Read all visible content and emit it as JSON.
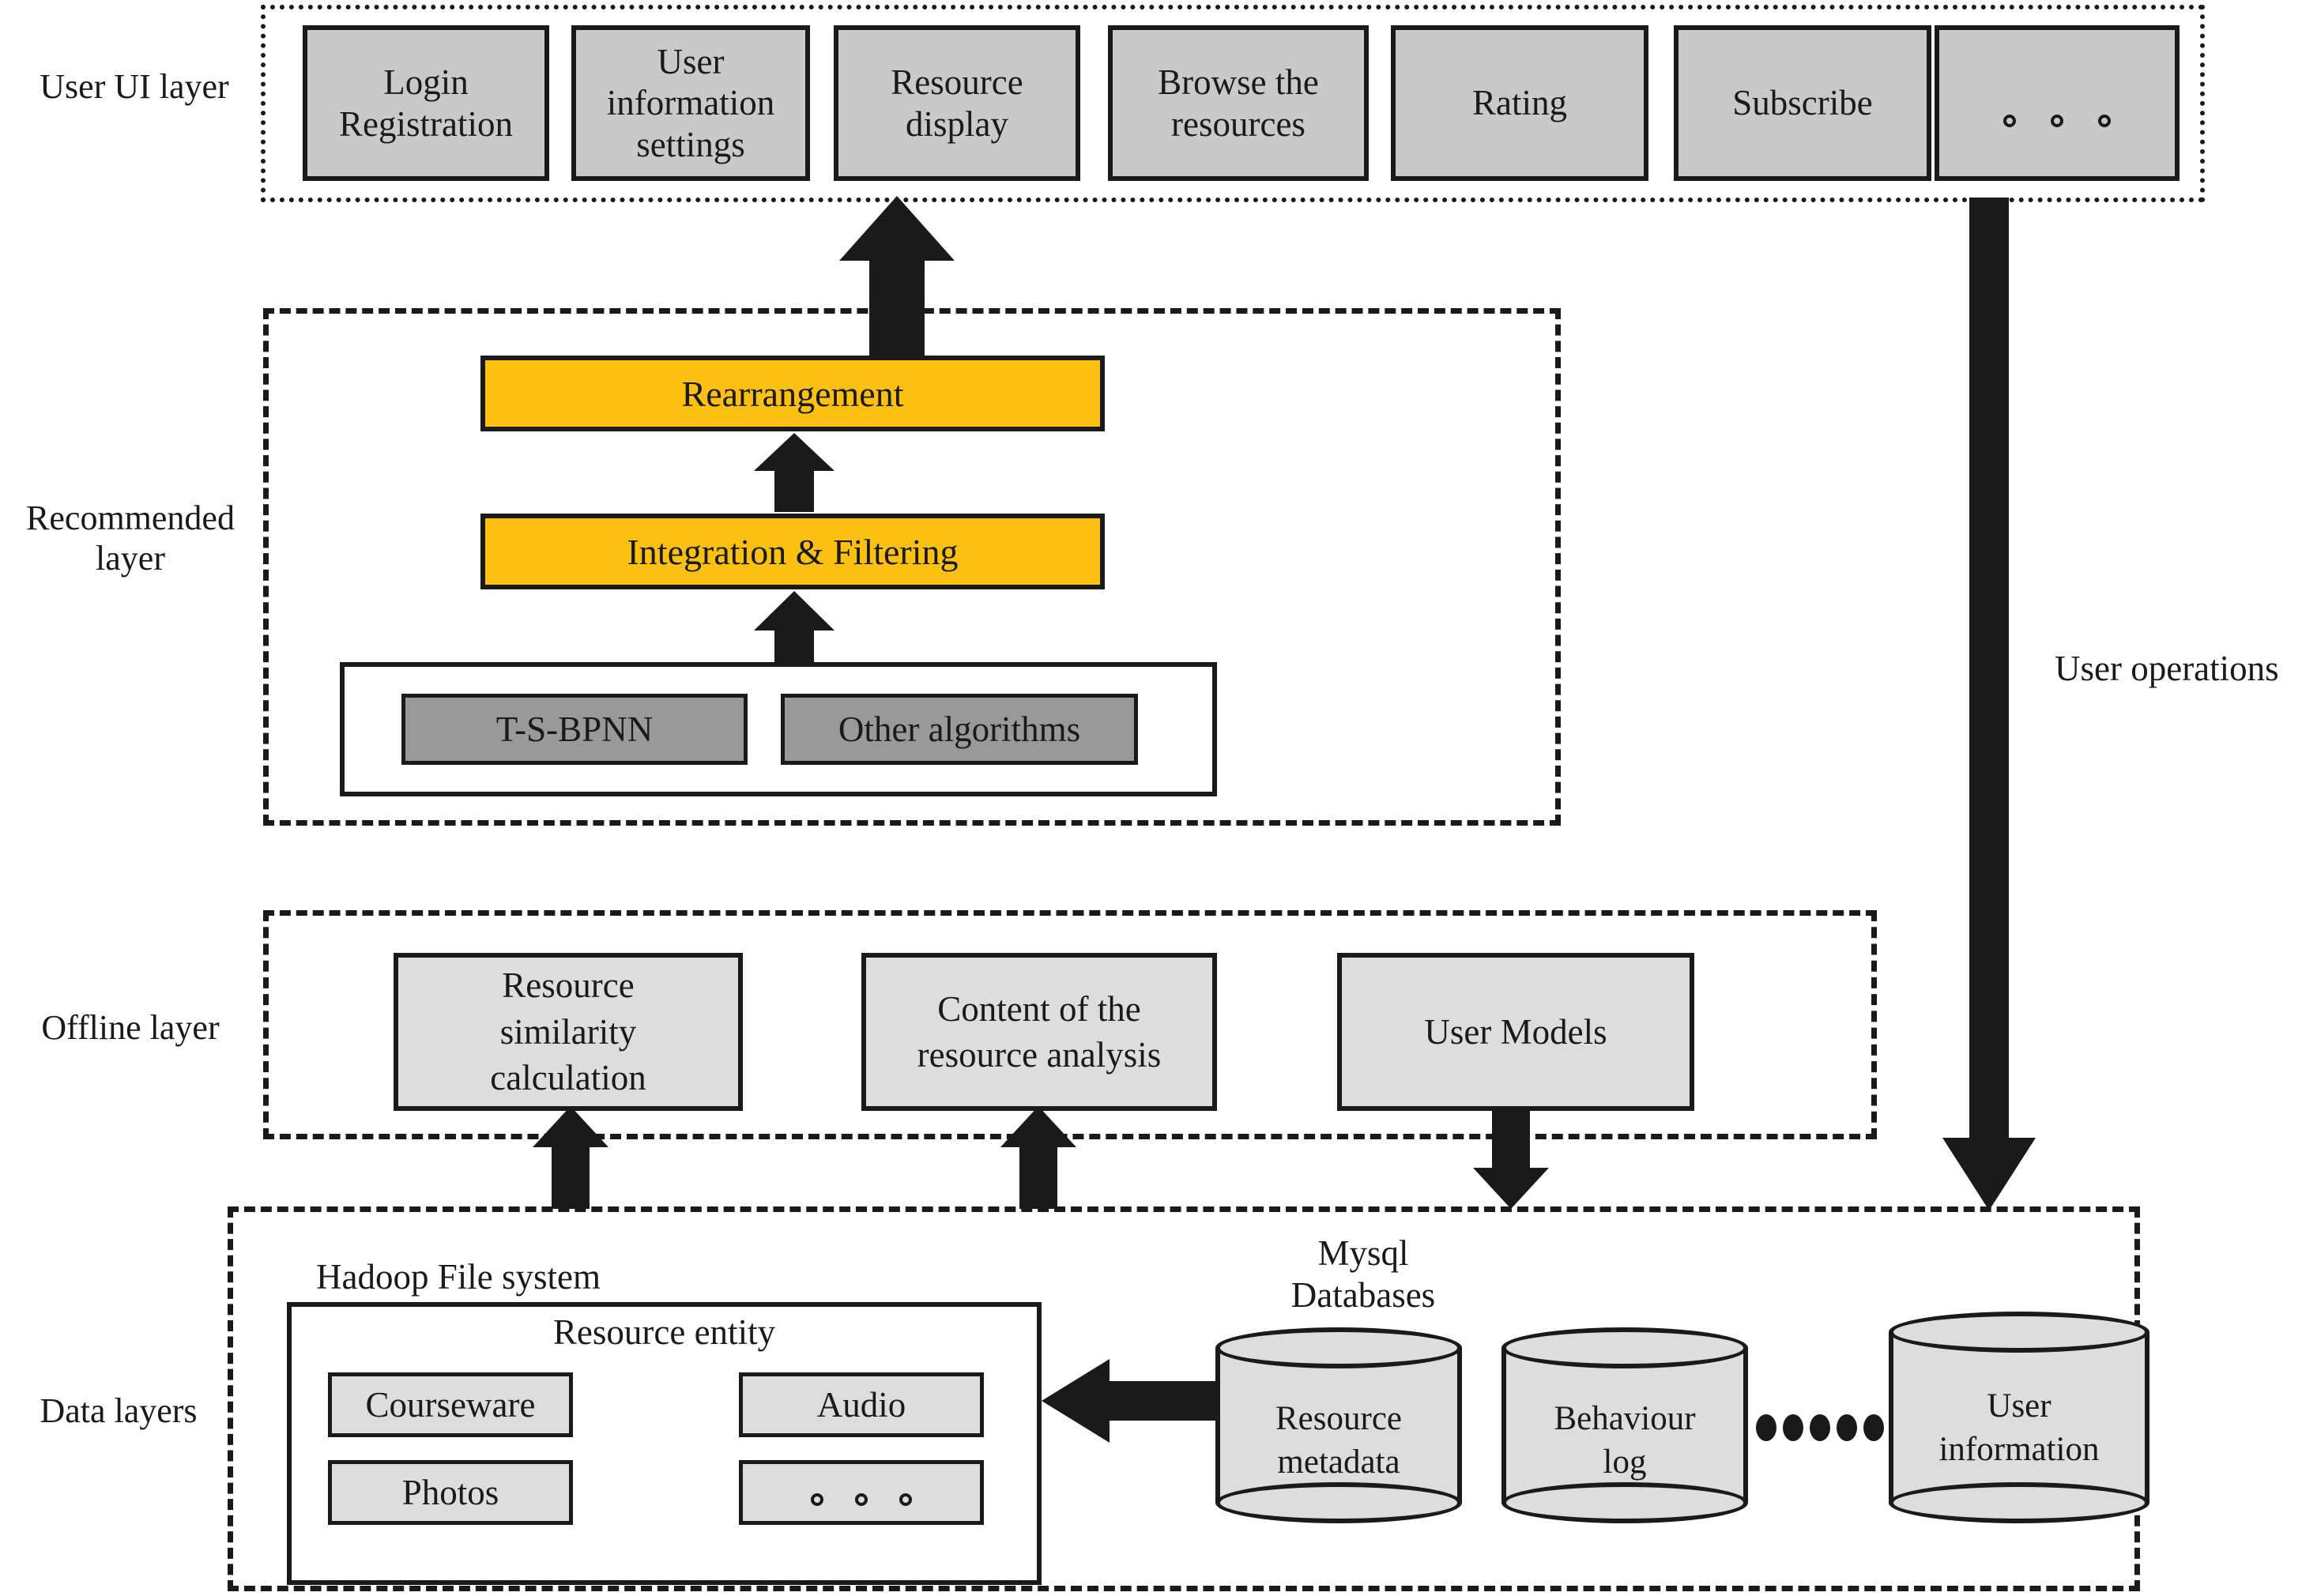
{
  "diagram": {
    "title": "Layered architecture of resource recommendation system",
    "colors": {
      "accent_yellow": "#fcc013",
      "ui_box_gray": "#c9c9c9",
      "algo_box_gray": "#98999b",
      "panel_gray": "#dddddd",
      "stroke": "#1a1a1a",
      "background": "#ffffff"
    }
  },
  "layers": {
    "ui": {
      "caption": "User UI layer"
    },
    "recommended": {
      "caption": "Recommended\nlayer",
      "caption_line1": "Recommended",
      "caption_line2": "layer"
    },
    "offline": {
      "caption": "Offline layer"
    },
    "data": {
      "caption": "Data layers"
    }
  },
  "ui_layer": {
    "boxes": [
      {
        "label": "Login\nRegistration",
        "line1": "Login",
        "line2": "Registration"
      },
      {
        "label": "User\ninformation\nsettings",
        "line1": "User",
        "line2": "information",
        "line3": "settings"
      },
      {
        "label": "Resource\ndisplay",
        "line1": "Resource",
        "line2": "display"
      },
      {
        "label": "Browse the\nresources",
        "line1": "Browse the",
        "line2": "resources"
      },
      {
        "label": "Rating",
        "line1": "Rating"
      },
      {
        "label": "Subscribe",
        "line1": "Subscribe"
      },
      {
        "label": "○ ○ ○",
        "line1": "",
        "is_ellipsis": true
      }
    ]
  },
  "recommended_layer": {
    "rearrangement": "Rearrangement",
    "integration_filtering": "Integration & Filtering",
    "algorithms": [
      {
        "label": "T-S-BPNN"
      },
      {
        "label": "Other algorithms"
      }
    ]
  },
  "offline_layer": {
    "boxes": [
      {
        "label": "Resource similarity calculation",
        "line1": "Resource",
        "line2": "similarity",
        "line3": "calculation"
      },
      {
        "label": "Content of the resource analysis",
        "line1": "Content of the",
        "line2": "resource analysis"
      },
      {
        "label": "User Models",
        "line1": "User Models"
      }
    ]
  },
  "data_layer": {
    "hadoop_label": "Hadoop File system",
    "resource_entity_label": "Resource entity",
    "resource_entity_items": [
      {
        "label": "Courseware"
      },
      {
        "label": "Audio"
      },
      {
        "label": "Photos"
      },
      {
        "label": "○ ○ ○",
        "is_ellipsis": true
      }
    ],
    "mysql_label_line1": "Mysql",
    "mysql_label_line2": "Databases",
    "databases": [
      {
        "line1": "Resource",
        "line2": "metadata"
      },
      {
        "line1": "Behaviour",
        "line2": "log"
      },
      {
        "line1": "User",
        "line2": "information"
      }
    ]
  },
  "annotations": {
    "user_operations": "User operations"
  }
}
